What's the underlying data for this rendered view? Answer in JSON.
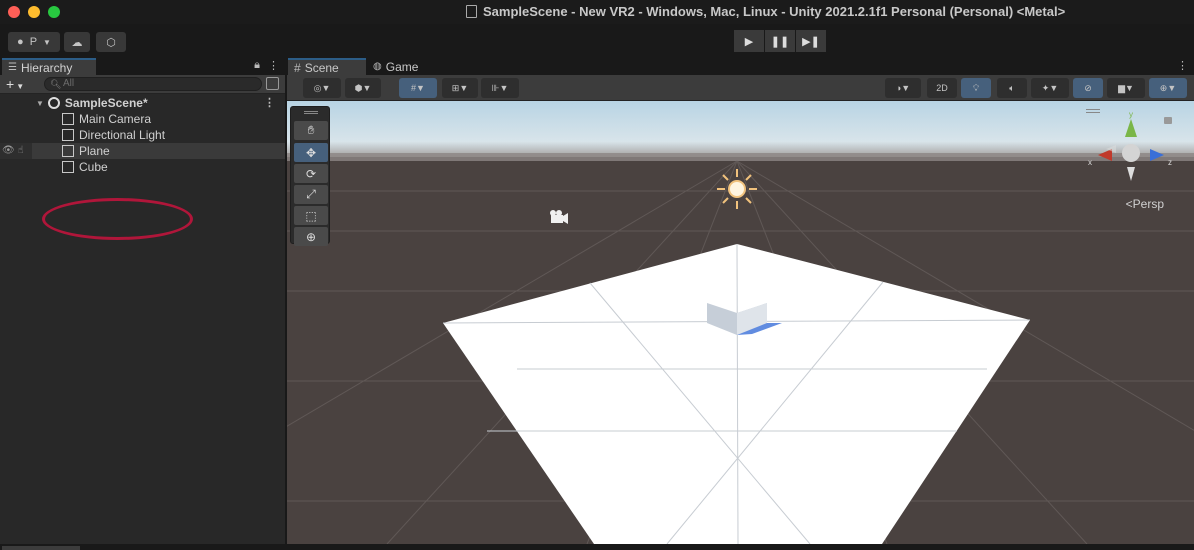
{
  "window": {
    "title": "SampleScene - New VR2 - Windows, Mac, Linux - Unity 2021.2.1f1 Personal (Personal) <Metal>"
  },
  "toolbar": {
    "account_label": "P",
    "account_icon": "account-icon",
    "cloud_icon": "cloud-icon",
    "collab_icon": "collab-icon",
    "play_icon": "play-icon",
    "pause_icon": "pause-icon",
    "step_icon": "step-icon"
  },
  "hierarchy": {
    "tab_label": "Hierarchy",
    "search_placeholder": "All",
    "scene_name": "SampleScene*",
    "items": [
      {
        "label": "Main Camera"
      },
      {
        "label": "Directional Light"
      },
      {
        "label": "Plane"
      },
      {
        "label": "Cube"
      }
    ],
    "highlight_color": "#b0163a"
  },
  "scene_view": {
    "tabs": [
      {
        "label": "Scene"
      },
      {
        "label": "Game"
      }
    ],
    "mode_2d_label": "2D",
    "persp_label": "Persp",
    "gizmo_axes": {
      "x": "x",
      "y": "y",
      "z": "z"
    },
    "colors": {
      "accent": "#46607c",
      "x_axis": "#c0392b",
      "y_axis": "#7ab648",
      "z_axis": "#3a6fd8",
      "ground": "#4a4240",
      "sky": "#b8d4e4"
    }
  }
}
